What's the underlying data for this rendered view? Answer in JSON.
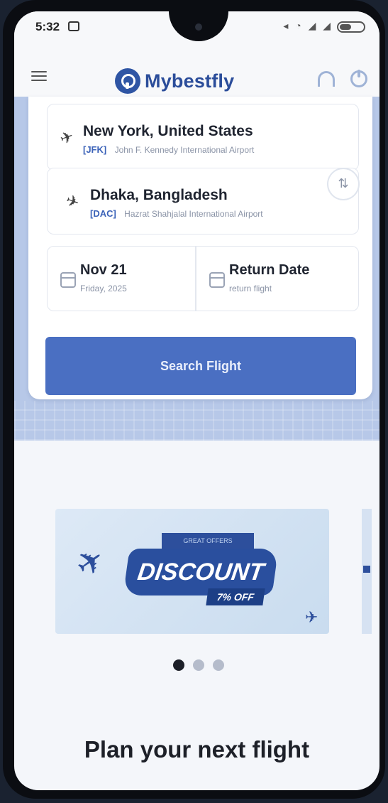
{
  "status_bar": {
    "time": "5:32"
  },
  "header": {
    "logo_text": "Mybestfly"
  },
  "search": {
    "from": {
      "city": "New York, United States",
      "code": "[JFK]",
      "airport": "John F. Kennedy International Airport"
    },
    "to": {
      "city": "Dhaka, Bangladesh",
      "code": "[DAC]",
      "airport": "Hazrat Shahjalal International Airport"
    },
    "depart": {
      "date": "Nov 21",
      "day": "Friday, 2025"
    },
    "return": {
      "label": "Return Date",
      "sub": "return flight"
    },
    "button_label": "Search Flight"
  },
  "banner": {
    "tag": "GREAT OFFERS",
    "headline": "DISCOUNT",
    "offer": "7% OFF"
  },
  "carousel": {
    "active_index": 0,
    "count": 3
  },
  "section": {
    "heading": "Plan your next flight"
  },
  "colors": {
    "primary": "#4a6fc2",
    "brand": "#2b4d9a",
    "band": "#b7c8e8"
  },
  "icons": {
    "menu": "hamburger-menu-icon",
    "support": "headset-icon",
    "logout": "power-icon",
    "departure": "plane-takeoff-icon",
    "arrival": "plane-landing-icon",
    "swap": "swap-vertical-icon",
    "calendar": "calendar-icon"
  }
}
